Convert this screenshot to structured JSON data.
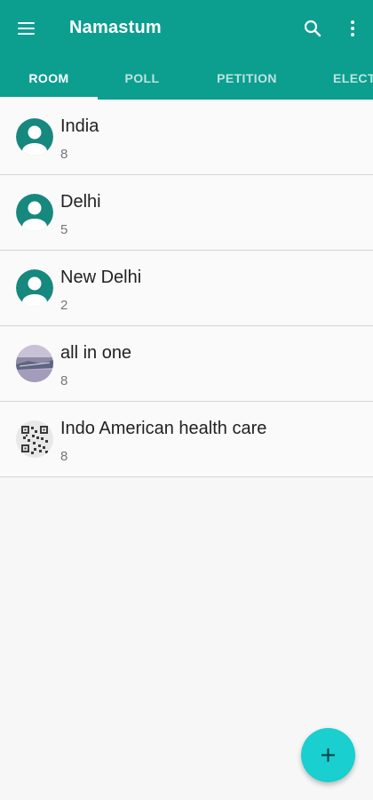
{
  "app": {
    "title": "Namastum",
    "accent_color": "#0c9e8f",
    "fab_color": "#19cfcf",
    "icons": {
      "menu": "hamburger-menu-icon",
      "search": "search-icon",
      "more": "more-vert-icon",
      "fab": "plus-icon"
    }
  },
  "tabs": [
    {
      "label": "ROOM",
      "active": true
    },
    {
      "label": "POLL",
      "active": false
    },
    {
      "label": "PETITION",
      "active": false
    },
    {
      "label": "ELECT",
      "active": false
    }
  ],
  "rooms": [
    {
      "name": "India",
      "count": "8",
      "avatar": "default-person-icon"
    },
    {
      "name": "Delhi",
      "count": "5",
      "avatar": "default-person-icon"
    },
    {
      "name": "New Delhi",
      "count": "2",
      "avatar": "default-person-icon"
    },
    {
      "name": "all in one",
      "count": "8",
      "avatar": "photo-thumbnail"
    },
    {
      "name": "Indo American health care",
      "count": "8",
      "avatar": "qr-code-thumbnail"
    }
  ]
}
